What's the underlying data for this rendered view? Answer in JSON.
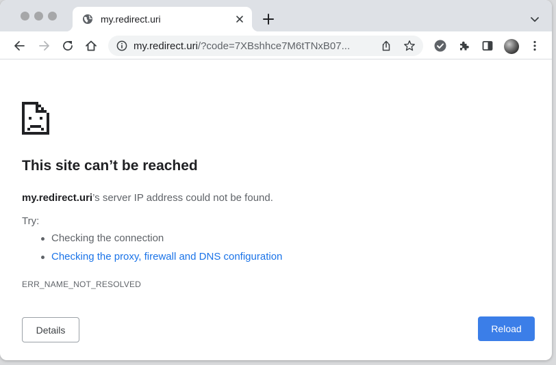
{
  "browser": {
    "tab": {
      "title": "my.redirect.uri",
      "favicon": "globe-icon"
    },
    "toolbar": {
      "url_host": "my.redirect.uri",
      "url_rest": "/?code=7XBshhce7M6tTNxB07..."
    }
  },
  "error_page": {
    "icon": "sad-file-icon",
    "heading": "This site can’t be reached",
    "host": "my.redirect.uri",
    "description_suffix": "’s server IP address could not be found.",
    "try_label": "Try:",
    "suggestions": [
      {
        "label": "Checking the connection",
        "is_link": false
      },
      {
        "label": "Checking the proxy, firewall and DNS configuration",
        "is_link": true
      }
    ],
    "error_code": "ERR_NAME_NOT_RESOLVED",
    "details_label": "Details",
    "reload_label": "Reload"
  },
  "colors": {
    "tabstrip": "#dee1e6",
    "link": "#1a73e8",
    "primary_button": "#3b7ee8",
    "text_primary": "#202124",
    "text_secondary": "#5f6368"
  }
}
